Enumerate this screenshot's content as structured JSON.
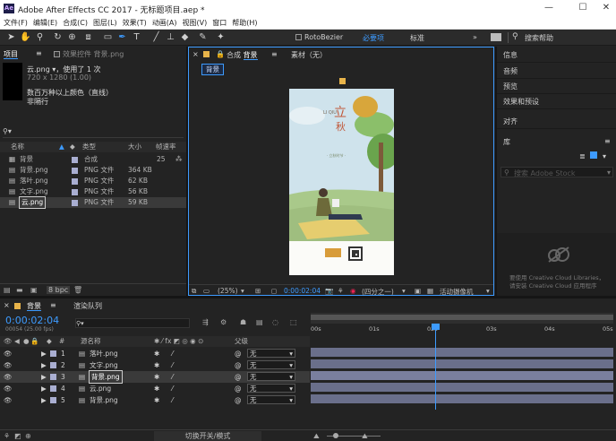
{
  "window": {
    "app_icon": "Ae",
    "title": "Adobe After Effects CC 2017 - 无标题项目.aep *",
    "minimize": "—",
    "maximize": "☐",
    "close": "✕"
  },
  "menu": [
    "文件(F)",
    "编辑(E)",
    "合成(C)",
    "图层(L)",
    "效果(T)",
    "动画(A)",
    "视图(V)",
    "窗口",
    "帮助(H)"
  ],
  "toolbar": {
    "rotobezier": "RotoBezier",
    "workspace_essentials": "必要项",
    "workspace_standard": "标准",
    "search_placeholder": "搜索帮助"
  },
  "project": {
    "tab": "项目",
    "effects_tab": "效果控件 背景.png",
    "selected_name": "云.png ▾",
    "used": "，使用了 1 次",
    "dims": "720 x 1280 (1.00)",
    "color": "数百万种以上颜色（直线）",
    "interlace": "非隔行",
    "search_glyph": "⚲▾",
    "columns": [
      "名称",
      "类型",
      "大小",
      "帧速率"
    ],
    "items": [
      {
        "name": "背景",
        "type": "合成",
        "size": "",
        "fps": "25",
        "color": "#a9aed1"
      },
      {
        "name": "背景.png",
        "type": "PNG 文件",
        "size": "364 KB",
        "fps": "",
        "color": "#a9aed1"
      },
      {
        "name": "落叶.png",
        "type": "PNG 文件",
        "size": "62 KB",
        "fps": "",
        "color": "#a9aed1"
      },
      {
        "name": "文字.png",
        "type": "PNG 文件",
        "size": "56 KB",
        "fps": "",
        "color": "#a9aed1"
      },
      {
        "name": "云.png",
        "type": "PNG 文件",
        "size": "59 KB",
        "fps": "",
        "color": "#a9aed1"
      }
    ],
    "bpc": "8 bpc"
  },
  "composition": {
    "tab_prefix": "合成",
    "tab_name": "背景",
    "footage_tab": "素材（无）",
    "layer_chip": "背景",
    "zoom": "(25%)",
    "timecode": "0:00:02:04",
    "resolution": "(四分之一)",
    "camera": "活动摄像机",
    "poster": {
      "title_char1": "立",
      "title_char2": "秋",
      "subtitle": "LI QIU",
      "small_text": "· 立秋时节 ·"
    }
  },
  "right_panel": {
    "items": [
      "信息",
      "音频",
      "预览",
      "效果和预设",
      "对齐"
    ],
    "library": "库",
    "library_search_placeholder": "搜索 Adobe Stock",
    "cc_message_1": "要使用 Creative Cloud Libraries，",
    "cc_message_2": "请安装 Creative Cloud 应用程序"
  },
  "timeline": {
    "tab": "背景",
    "render_tab": "渲染队列",
    "timecode": "0:00:02:04",
    "frame_info": "00054 (25.00 fps)",
    "search_glyph": "⚲▾",
    "col_source": "源名称",
    "col_parent": "父级",
    "ruler": [
      "00s",
      "01s",
      "02s",
      "03s",
      "04s",
      "05s"
    ],
    "playhead_fraction": 0.425,
    "layers": [
      {
        "num": "1",
        "name": "落叶.png",
        "parent": "无"
      },
      {
        "num": "2",
        "name": "文字.png",
        "parent": "无"
      },
      {
        "num": "3",
        "name": "背景.png",
        "parent": "无"
      },
      {
        "num": "4",
        "name": "云.png",
        "parent": "无"
      },
      {
        "num": "5",
        "name": "背景.png",
        "parent": "无"
      }
    ],
    "selected_layer_index": 2,
    "footer": "切换开关/模式"
  }
}
